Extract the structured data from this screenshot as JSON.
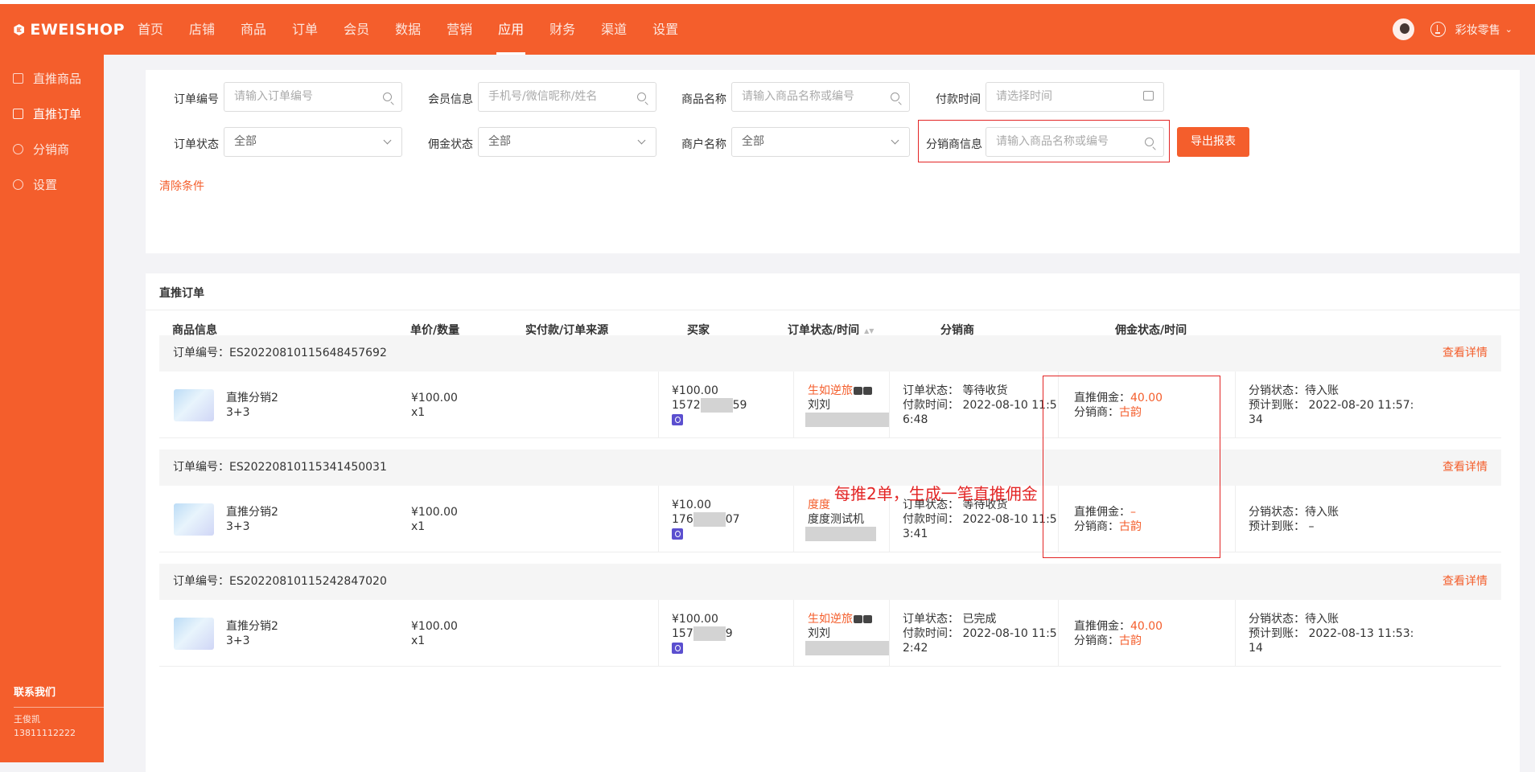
{
  "app": {
    "logo_text": "EWEISHOP",
    "shop_name": "彩妆零售"
  },
  "nav": [
    "首页",
    "店铺",
    "商品",
    "订单",
    "会员",
    "数据",
    "营销",
    "应用",
    "财务",
    "渠道",
    "设置"
  ],
  "nav_active": 7,
  "sidebar": {
    "items": [
      {
        "label": "直推商品",
        "icon": "goods-icon"
      },
      {
        "label": "直推订单",
        "icon": "order-icon"
      },
      {
        "label": "分销商",
        "icon": "users-icon"
      },
      {
        "label": "设置",
        "icon": "gear-icon"
      }
    ],
    "active": 1,
    "contact_title": "联系我们",
    "contact_name": "王俊凯",
    "contact_phone": "13811112222"
  },
  "filters": {
    "order_no": {
      "label": "订单编号",
      "placeholder": "请输入订单编号"
    },
    "member": {
      "label": "会员信息",
      "placeholder": "手机号/微信昵称/姓名"
    },
    "goods": {
      "label": "商品名称",
      "placeholder": "请输入商品名称或编号"
    },
    "pay_time": {
      "label": "付款时间",
      "placeholder": "请选择时间"
    },
    "order_status": {
      "label": "订单状态",
      "value": "全部"
    },
    "commission_status": {
      "label": "佣金状态",
      "value": "全部"
    },
    "merchant": {
      "label": "商户名称",
      "value": "全部"
    },
    "distributor": {
      "label": "分销商信息",
      "placeholder": "请输入商品名称或编号"
    },
    "export_label": "导出报表",
    "clear_label": "清除条件"
  },
  "panel": {
    "title": "直推订单",
    "columns": [
      "商品信息",
      "单价/数量",
      "实付款/订单来源",
      "买家",
      "订单状态/时间",
      "分销商",
      "佣金状态/时间"
    ],
    "detail_label": "查看详情"
  },
  "orders": [
    {
      "no": "订单编号：ES20220810115648457692",
      "goods_name": "直推分销2",
      "goods_spec": "3+3",
      "price": "¥100.00",
      "qty": "x1",
      "paid": "¥100.00",
      "phone_a": "1572",
      "phone_b": "59",
      "buyer_nick": "生如逆旅",
      "buyer_name": "刘刘",
      "status": "订单状态： 等待收货",
      "pay_time_1": "付款时间： 2022-08-10 11:5",
      "pay_time_2": "6:48",
      "commission": "直推佣金：",
      "commission_value": "40.00",
      "distributor": "分销商：",
      "distributor_value": "古韵",
      "dist_status": "分销状态：待入账",
      "arrive_1": "预计到账： 2022-08-20 11:57:",
      "arrive_2": "34"
    },
    {
      "no": "订单编号：ES20220810115341450031",
      "goods_name": "直推分销2",
      "goods_spec": "3+3",
      "price": "¥100.00",
      "qty": "x1",
      "paid": "¥10.00",
      "phone_a": "176",
      "phone_b": "07",
      "buyer_nick": "度度",
      "buyer_name": "度度测试机",
      "status": "订单状态： 等待收货",
      "pay_time_1": "付款时间： 2022-08-10 11:5",
      "pay_time_2": "3:41",
      "commission": "直推佣金：",
      "commission_value": "–",
      "distributor": "分销商：",
      "distributor_value": "古韵",
      "dist_status": "分销状态：待入账",
      "arrive_1": "预计到账： –",
      "arrive_2": ""
    },
    {
      "no": "订单编号：ES20220810115242847020",
      "goods_name": "直推分销2",
      "goods_spec": "3+3",
      "price": "¥100.00",
      "qty": "x1",
      "paid": "¥100.00",
      "phone_a": "157",
      "phone_b": "9",
      "buyer_nick": "生如逆旅",
      "buyer_name": "刘刘",
      "status": "订单状态： 已完成",
      "pay_time_1": "付款时间： 2022-08-10 11:5",
      "pay_time_2": "2:42",
      "commission": "直推佣金：",
      "commission_value": "40.00",
      "distributor": "分销商：",
      "distributor_value": "古韵",
      "dist_status": "分销状态：待入账",
      "arrive_1": "预计到账： 2022-08-13 11:53:",
      "arrive_2": "14"
    }
  ],
  "annotation": "每推2单，生成一笔直推佣金",
  "colors": {
    "brand": "#f45e2c",
    "annotation": "#e32525"
  }
}
